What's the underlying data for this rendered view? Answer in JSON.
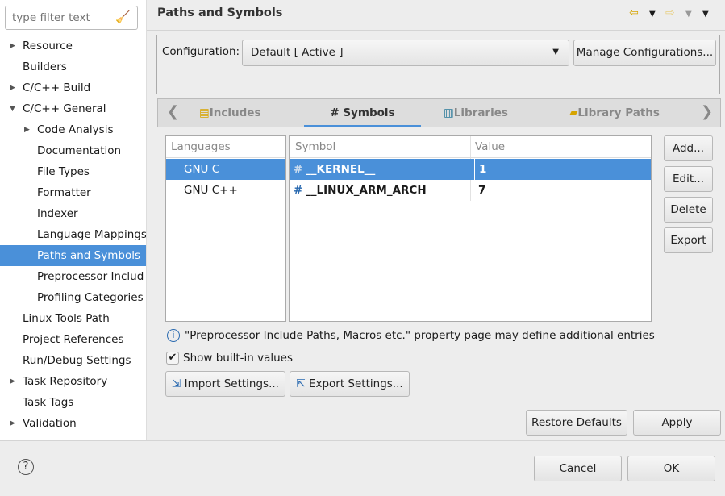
{
  "sidebar": {
    "filter_placeholder": "type filter text",
    "items": [
      {
        "label": "Resource",
        "level": 0,
        "expander": "collapsed"
      },
      {
        "label": "Builders",
        "level": 0,
        "expander": "none"
      },
      {
        "label": "C/C++ Build",
        "level": 0,
        "expander": "collapsed"
      },
      {
        "label": "C/C++ General",
        "level": 0,
        "expander": "expanded"
      },
      {
        "label": "Code Analysis",
        "level": 1,
        "expander": "collapsed"
      },
      {
        "label": "Documentation",
        "level": 1,
        "expander": "none"
      },
      {
        "label": "File Types",
        "level": 1,
        "expander": "none"
      },
      {
        "label": "Formatter",
        "level": 1,
        "expander": "none"
      },
      {
        "label": "Indexer",
        "level": 1,
        "expander": "none"
      },
      {
        "label": "Language Mappings",
        "level": 1,
        "expander": "none"
      },
      {
        "label": "Paths and Symbols",
        "level": 1,
        "expander": "none",
        "selected": true
      },
      {
        "label": "Preprocessor Includ",
        "level": 1,
        "expander": "none"
      },
      {
        "label": "Profiling Categories",
        "level": 1,
        "expander": "none"
      },
      {
        "label": "Linux Tools Path",
        "level": 0,
        "expander": "none"
      },
      {
        "label": "Project References",
        "level": 0,
        "expander": "none"
      },
      {
        "label": "Run/Debug Settings",
        "level": 0,
        "expander": "none"
      },
      {
        "label": "Task Repository",
        "level": 0,
        "expander": "collapsed"
      },
      {
        "label": "Task Tags",
        "level": 0,
        "expander": "none"
      },
      {
        "label": "Validation",
        "level": 0,
        "expander": "collapsed"
      }
    ]
  },
  "header": {
    "title": "Paths and Symbols"
  },
  "config": {
    "label": "Configuration:",
    "value": "Default  [ Active ]",
    "manage_label": "Manage Configurations..."
  },
  "tabs": [
    {
      "label": "Includes"
    },
    {
      "label": "# Symbols",
      "active": true
    },
    {
      "label": "Libraries"
    },
    {
      "label": "Library Paths"
    }
  ],
  "languages": {
    "header": "Languages",
    "items": [
      {
        "label": "GNU C",
        "selected": true
      },
      {
        "label": "GNU C++"
      }
    ]
  },
  "symbols": {
    "headers": [
      "Symbol",
      "Value"
    ],
    "rows": [
      {
        "symbol": "__KERNEL__",
        "value": "1",
        "selected": true
      },
      {
        "symbol": "__LINUX_ARM_ARCH",
        "value": "7"
      }
    ]
  },
  "side_buttons": [
    "Add...",
    "Edit...",
    "Delete",
    "Export"
  ],
  "info_text": "\"Preprocessor Include Paths, Macros etc.\" property page may define additional entries",
  "show_builtin": {
    "label": "Show built-in values",
    "checked": true
  },
  "import_label": "Import Settings...",
  "export_label": "Export Settings...",
  "restore_label": "Restore Defaults",
  "apply_label": "Apply",
  "cancel_label": "Cancel",
  "ok_label": "OK",
  "colors": {
    "selection": "#4a90d9",
    "accent": "#4a90d9"
  }
}
